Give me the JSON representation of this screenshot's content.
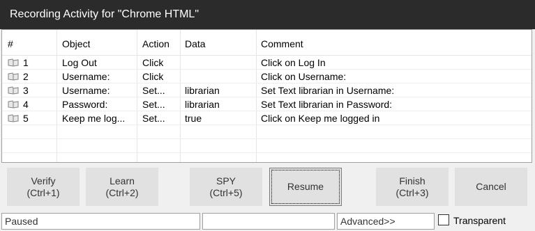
{
  "window": {
    "title": "Recording Activity for \"Chrome HTML\""
  },
  "table": {
    "columns": [
      "#",
      "Object",
      "Action",
      "Data",
      "Comment"
    ],
    "rows": [
      {
        "num": "1",
        "object": "Log Out",
        "action": "Click",
        "data": "",
        "comment": "Click on Log In",
        "icon": "step-icon"
      },
      {
        "num": "2",
        "object": "Username:",
        "action": "Click",
        "data": "",
        "comment": "Click on Username:",
        "icon": "step-icon"
      },
      {
        "num": "3",
        "object": "Username:",
        "action": "Set...",
        "data": "librarian",
        "comment": "Set Text librarian in Username:",
        "icon": "step-icon"
      },
      {
        "num": "4",
        "object": "Password:",
        "action": "Set...",
        "data": "librarian",
        "comment": "Set Text librarian in Password:",
        "icon": "step-icon"
      },
      {
        "num": "5",
        "object": "Keep me log...",
        "action": "Set...",
        "data": "true",
        "comment": "Click on Keep me logged in",
        "icon": "step-icon"
      }
    ]
  },
  "buttons": {
    "verify": [
      "Verify",
      "(Ctrl+1)"
    ],
    "learn": [
      "Learn",
      "(Ctrl+2)"
    ],
    "spy": [
      "SPY",
      "(Ctrl+5)"
    ],
    "resume": "Resume",
    "finish": [
      "Finish",
      "(Ctrl+3)"
    ],
    "cancel": "Cancel"
  },
  "statusbar": {
    "status": "Paused",
    "middle": "",
    "advanced": "Advanced>>",
    "transparent_label": "Transparent",
    "transparent_checked": false
  }
}
